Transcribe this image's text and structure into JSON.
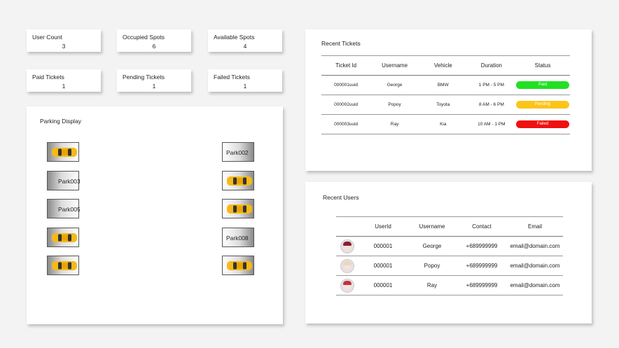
{
  "stats": [
    {
      "label": "User Count",
      "value": "3"
    },
    {
      "label": "Occupied Spots",
      "value": "6"
    },
    {
      "label": "Available Spots",
      "value": "4"
    },
    {
      "label": "Paid Tickets",
      "value": "1"
    },
    {
      "label": "Pending Tickets",
      "value": "1"
    },
    {
      "label": "Failed Tickets",
      "value": "1"
    }
  ],
  "parking": {
    "title": "Parking Display",
    "spots": [
      {
        "label": "",
        "occupied": true
      },
      {
        "label": "Park002",
        "occupied": false
      },
      {
        "label": "Park003",
        "occupied": false
      },
      {
        "label": "",
        "occupied": true
      },
      {
        "label": "Park005",
        "occupied": false
      },
      {
        "label": "",
        "occupied": true
      },
      {
        "label": "",
        "occupied": true
      },
      {
        "label": "Park008",
        "occupied": false
      },
      {
        "label": "",
        "occupied": true
      },
      {
        "label": "",
        "occupied": true
      }
    ]
  },
  "tickets": {
    "title": "Recent Tickets",
    "headers": [
      "Ticket Id",
      "Username",
      "Vehicle",
      "Duration",
      "Status"
    ],
    "rows": [
      {
        "id": "000001uuid",
        "username": "George",
        "vehicle": "BMW",
        "duration": "1 PM - 5 PM",
        "status": "Paid",
        "color": "#22e022"
      },
      {
        "id": "000002uuid",
        "username": "Popoy",
        "vehicle": "Toyota",
        "duration": "8 AM - 6 PM",
        "status": "Pending",
        "color": "#fcc419"
      },
      {
        "id": "000003uuid",
        "username": "Ray",
        "vehicle": "Kia",
        "duration": "10 AM - 1 PM",
        "status": "Failed",
        "color": "#f01010"
      }
    ]
  },
  "users": {
    "title": "Recent Users",
    "headers": [
      "",
      "UserId",
      "Username",
      "Contact",
      "Email"
    ],
    "rows": [
      {
        "avatar": "user-avatar-icon",
        "userid": "000001",
        "username": "George",
        "contact": "+689999999",
        "email": "email@domain.com"
      },
      {
        "avatar": "user-avatar-icon",
        "userid": "000001",
        "username": "Popoy",
        "contact": "+689999999",
        "email": "email@domain.com"
      },
      {
        "avatar": "user-avatar-icon",
        "userid": "000001",
        "username": "Ray",
        "contact": "+689999999",
        "email": "email@domain.com"
      }
    ]
  },
  "colors": {
    "car_body": "#f5b91a",
    "car_window": "#333333"
  }
}
